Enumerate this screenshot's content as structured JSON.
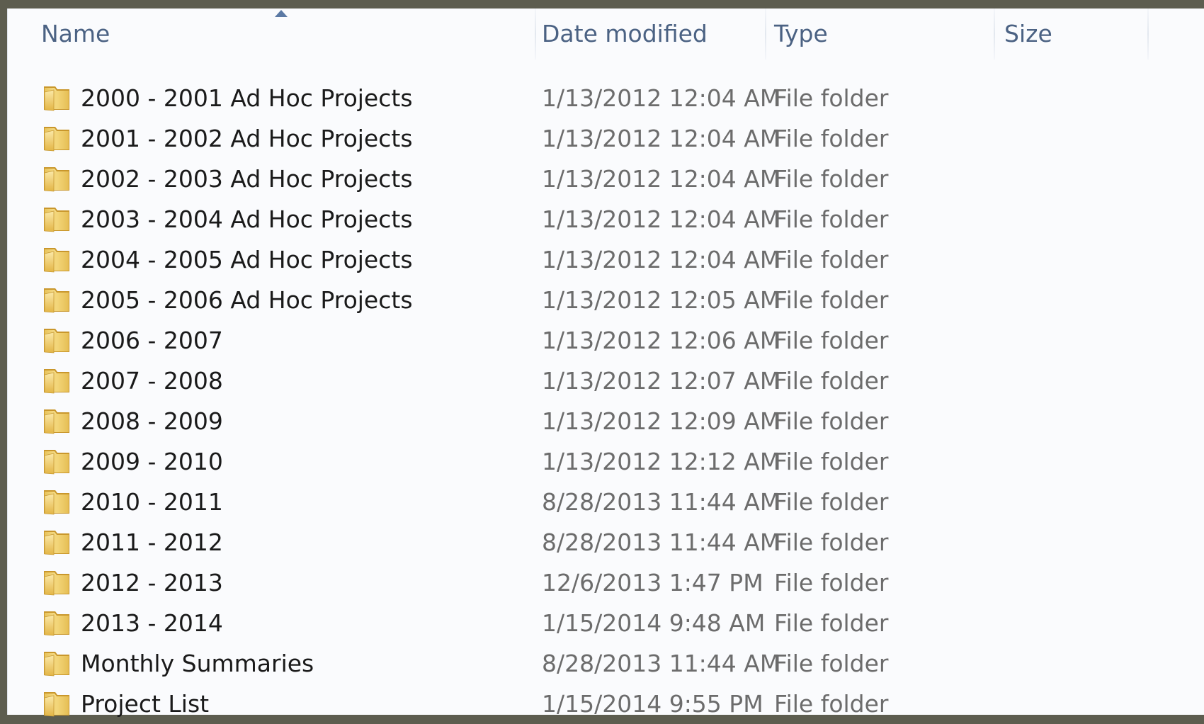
{
  "columns": {
    "name": "Name",
    "date_modified": "Date modified",
    "type": "Type",
    "size": "Size"
  },
  "sort": {
    "column": "Name",
    "direction": "ascending"
  },
  "icon": "folder-icon",
  "rows": [
    {
      "name": "2000 - 2001 Ad Hoc Projects",
      "date": "1/13/2012 12:04 AM",
      "type": "File folder",
      "size": ""
    },
    {
      "name": "2001 - 2002 Ad Hoc Projects",
      "date": "1/13/2012 12:04 AM",
      "type": "File folder",
      "size": ""
    },
    {
      "name": "2002 - 2003 Ad Hoc Projects",
      "date": "1/13/2012 12:04 AM",
      "type": "File folder",
      "size": ""
    },
    {
      "name": "2003 - 2004 Ad Hoc Projects",
      "date": "1/13/2012 12:04 AM",
      "type": "File folder",
      "size": ""
    },
    {
      "name": "2004 - 2005 Ad Hoc Projects",
      "date": "1/13/2012 12:04 AM",
      "type": "File folder",
      "size": ""
    },
    {
      "name": "2005 - 2006 Ad Hoc Projects",
      "date": "1/13/2012 12:05 AM",
      "type": "File folder",
      "size": ""
    },
    {
      "name": "2006 - 2007",
      "date": "1/13/2012 12:06 AM",
      "type": "File folder",
      "size": ""
    },
    {
      "name": "2007 - 2008",
      "date": "1/13/2012 12:07 AM",
      "type": "File folder",
      "size": ""
    },
    {
      "name": "2008 - 2009",
      "date": "1/13/2012 12:09 AM",
      "type": "File folder",
      "size": ""
    },
    {
      "name": "2009 - 2010",
      "date": "1/13/2012 12:12 AM",
      "type": "File folder",
      "size": ""
    },
    {
      "name": "2010 - 2011",
      "date": "8/28/2013 11:44 AM",
      "type": "File folder",
      "size": ""
    },
    {
      "name": "2011 - 2012",
      "date": "8/28/2013 11:44 AM",
      "type": "File folder",
      "size": ""
    },
    {
      "name": "2012 - 2013",
      "date": "12/6/2013 1:47 PM",
      "type": "File folder",
      "size": ""
    },
    {
      "name": "2013 - 2014",
      "date": "1/15/2014 9:48 AM",
      "type": "File folder",
      "size": ""
    },
    {
      "name": "Monthly Summaries",
      "date": "8/28/2013 11:44 AM",
      "type": "File folder",
      "size": ""
    },
    {
      "name": "Project List",
      "date": "1/15/2014 9:55 PM",
      "type": "File folder",
      "size": ""
    }
  ]
}
